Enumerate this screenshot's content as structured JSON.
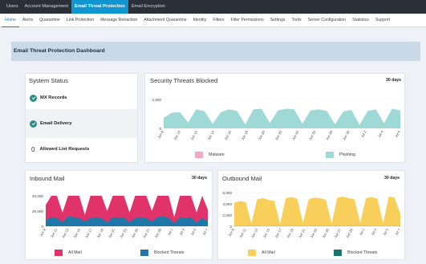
{
  "topnav": {
    "items": [
      {
        "label": "Users"
      },
      {
        "label": "Account Management"
      },
      {
        "label": "Email Threat Protection",
        "active": true
      },
      {
        "label": "Email Encryption"
      }
    ]
  },
  "subnav": {
    "items": [
      {
        "label": "Home",
        "active": true
      },
      {
        "label": "Alerts"
      },
      {
        "label": "Quarantine"
      },
      {
        "label": "Link Protection"
      },
      {
        "label": "Message Retraction"
      },
      {
        "label": "Attachment Quarantine"
      },
      {
        "label": "Identity"
      },
      {
        "label": "Filters"
      },
      {
        "label": "Filter Permissions"
      },
      {
        "label": "Settings"
      },
      {
        "label": "Tools"
      },
      {
        "label": "Server Configuration"
      },
      {
        "label": "Statistics"
      },
      {
        "label": "Support"
      }
    ]
  },
  "dashboard": {
    "title": "Email Threat Protection Dashboard"
  },
  "system_status": {
    "title": "System Status",
    "rows": [
      {
        "icon": "check-circle-icon",
        "label": "MX Records"
      },
      {
        "icon": "check-circle-icon",
        "label": "Email Delivery"
      },
      {
        "count": "0",
        "label": "Allowed List Requests"
      }
    ]
  },
  "colors": {
    "malware": "#f2a7c3",
    "phishing": "#9fd9d6",
    "all_mail_inbound": "#e0336a",
    "blocked_inbound": "#1f78a8",
    "all_mail_outbound": "#f7cf5a",
    "blocked_outbound": "#16756c",
    "check": "#2a8f86"
  },
  "chart_data": [
    {
      "id": "security",
      "type": "area",
      "title": "Security Threats Blocked",
      "range_label": "30 days",
      "ylim": [
        0,
        2500
      ],
      "yticks": [
        "2,500",
        "0"
      ],
      "categories": [
        "Jun 8",
        "Jun 10",
        "Jun 12",
        "Jun 14",
        "Jun 16",
        "Jun 18",
        "Jun 20",
        "Jun 22",
        "Jun 24",
        "Jun 26",
        "Jun 28",
        "Jun 30",
        "Jul 2",
        "Jul 4",
        "Jul 6"
      ],
      "series": [
        {
          "name": "Malware",
          "color": "#f2a7c3",
          "values": [
            5,
            5,
            5,
            5,
            5,
            5,
            5,
            5,
            5,
            5,
            5,
            5,
            5,
            5,
            5,
            5,
            5,
            5,
            5,
            5,
            5,
            5,
            5,
            5,
            5,
            5,
            5,
            5,
            5,
            5
          ]
        },
        {
          "name": "Phishing",
          "color": "#9fd9d6",
          "values": [
            900,
            1350,
            1400,
            500,
            1650,
            1500,
            400,
            1400,
            1650,
            1500,
            350,
            1650,
            1700,
            450,
            1550,
            1700,
            1650,
            400,
            1550,
            1650,
            1500,
            350,
            1450,
            1600,
            300,
            1500,
            1650,
            450,
            1700,
            1550
          ]
        }
      ],
      "legend": [
        "Malware",
        "Phishing"
      ]
    },
    {
      "id": "inbound",
      "type": "area",
      "title": "Inbound Mail",
      "range_label": "30 days",
      "ylim": [
        0,
        40000
      ],
      "yticks": [
        "40,000",
        "20,000",
        "0"
      ],
      "categories": [
        "Jun 9",
        "Jun 11",
        "Jun 13",
        "Jun 15",
        "Jun 17",
        "Jun 19",
        "Jun 21",
        "Jun 23",
        "Jun 25",
        "Jun 27",
        "Jun 29",
        "Jul 1",
        "Jul 3",
        "Jul 5",
        "Jul 7"
      ],
      "series": [
        {
          "name": "All Mail",
          "color": "#e0336a",
          "values": [
            28000,
            42000,
            40000,
            18000,
            44000,
            43000,
            41000,
            15000,
            40000,
            42000,
            41000,
            20000,
            42000,
            43000,
            40000,
            18000,
            41000,
            42000,
            43000,
            20000,
            40000,
            44000,
            41000,
            12000,
            40000,
            42000,
            45000,
            18000,
            40000,
            22000
          ]
        },
        {
          "name": "Blocked Threats",
          "color": "#1f78a8",
          "values": [
            8000,
            12000,
            11000,
            5000,
            13000,
            12000,
            11000,
            6000,
            11000,
            12000,
            11000,
            5000,
            12000,
            11000,
            12000,
            5000,
            11000,
            12000,
            11000,
            6000,
            12000,
            13000,
            11000,
            4000,
            12000,
            11000,
            12000,
            5000,
            11000,
            7000
          ]
        }
      ],
      "legend": [
        "All Mail",
        "Blocked Threats"
      ]
    },
    {
      "id": "outbound",
      "type": "area",
      "title": "Outbound Mail",
      "range_label": "30 days",
      "ylim": [
        0,
        6000
      ],
      "yticks": [
        "6,000",
        "4,000",
        "2,000",
        "0"
      ],
      "categories": [
        "Jun 9",
        "Jun 11",
        "Jun 13",
        "Jun 15",
        "Jun 17",
        "Jun 19",
        "Jun 21",
        "Jun 23",
        "Jun 25",
        "Jun 27",
        "Jun 29",
        "Jul 1",
        "Jul 3",
        "Jul 5",
        "Jul 7"
      ],
      "series": [
        {
          "name": "All Mail",
          "color": "#f7cf5a",
          "values": [
            4200,
            4500,
            4300,
            500,
            4800,
            5000,
            4700,
            4500,
            400,
            5000,
            5200,
            4900,
            600,
            4800,
            5100,
            5000,
            4700,
            500,
            5100,
            5300,
            5000,
            4800,
            600,
            5000,
            5200,
            4900,
            500,
            5300,
            5100,
            2200
          ]
        },
        {
          "name": "Blocked Threats",
          "color": "#16756c",
          "values": [
            15,
            15,
            15,
            15,
            15,
            15,
            15,
            15,
            15,
            15,
            15,
            15,
            15,
            15,
            15,
            15,
            15,
            15,
            15,
            15,
            15,
            15,
            15,
            15,
            15,
            15,
            15,
            15,
            15,
            15
          ]
        }
      ],
      "legend": [
        "All Mail",
        "Blocked Threats"
      ]
    }
  ]
}
